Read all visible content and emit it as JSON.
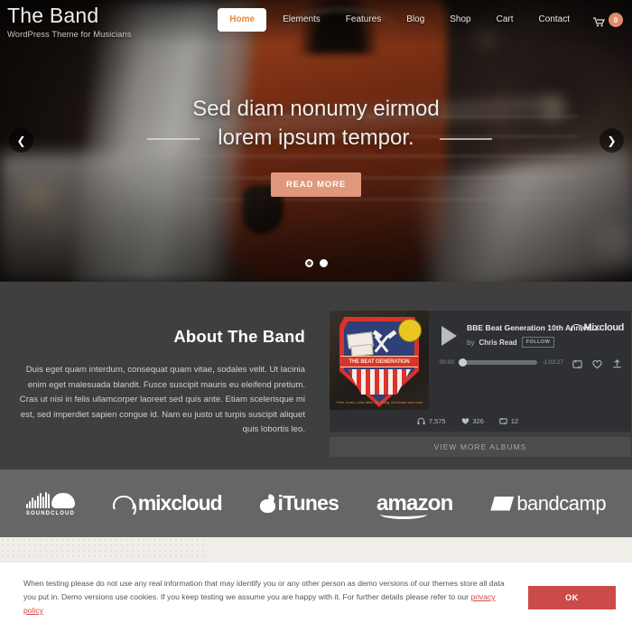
{
  "header": {
    "brand_title": "The Band",
    "brand_subtitle": "WordPress Theme for Musicians",
    "nav": [
      {
        "label": "Home",
        "active": true
      },
      {
        "label": "Elements",
        "active": false
      },
      {
        "label": "Features",
        "active": false
      },
      {
        "label": "Blog",
        "active": false
      },
      {
        "label": "Shop",
        "active": false
      },
      {
        "label": "Cart",
        "active": false
      },
      {
        "label": "Contact",
        "active": false
      }
    ],
    "cart_icon": "shopping-cart-icon",
    "cart_count": "0",
    "accent_color": "#e8883e",
    "badge_color": "#e08a6b"
  },
  "hero": {
    "title_line1": "Sed diam nonumy eirmod",
    "title_line2": "lorem ipsum tempor.",
    "button_label": "READ MORE",
    "button_color": "#e0977c",
    "prev_icon": "chevron-left-icon",
    "next_icon": "chevron-right-icon",
    "slide_count": 2,
    "active_slide": 2
  },
  "about": {
    "heading": "About The Band",
    "paragraph": "Duis eget quam interdum, consequat quam vitae, sodales velit. Ut lacinia enim eget malesuada blandit. Fusce suscipit mauris eu eleifend pretium. Cras ut nisi in felis ullamcorper laoreet sed quis ante. Etiam scelerisque mi est, sed imperdiet sapien congue id. Nam eu justo ut turpis suscipit aliquet quis lobortis leo.",
    "background_color": "#3f3f3f"
  },
  "player": {
    "cover_alt": "the-beat-generation-album-art",
    "cover_banner_text": "THE BEAT GENERATION",
    "cover_footer_text": "Pete Jones, Little Mike, Mr Thing, Mr Brown and more",
    "play_icon": "play-icon",
    "track_title": "BBE Beat Generation 10th Annive...",
    "by_prefix": "by",
    "artist": "Chris Read",
    "follow_label": "FOLLOW",
    "service": "Mixcloud",
    "service_icon": "mixcloud-cloud-icon",
    "time_elapsed": "00:00",
    "time_remaining": "-1:03:27",
    "repost_icon": "repost-icon",
    "heart_icon": "heart-icon",
    "share_icon": "share-upload-icon",
    "stats": [
      {
        "icon": "headphones-icon",
        "value": "7,575"
      },
      {
        "icon": "heart-filled-icon",
        "value": "326"
      },
      {
        "icon": "repost-icon",
        "value": "12"
      }
    ],
    "view_more_label": "VIEW MORE ALBUMS",
    "background_color": "#2e3034"
  },
  "logos": {
    "background_color": "#666666",
    "items": [
      {
        "name": "soundcloud-logo",
        "label": "SOUNDCLOUD"
      },
      {
        "name": "mixcloud-logo",
        "label": "mixcloud"
      },
      {
        "name": "itunes-logo",
        "label": "iTunes"
      },
      {
        "name": "amazon-logo",
        "label": "amazon"
      },
      {
        "name": "bandcamp-logo",
        "label": "bandcamp"
      }
    ]
  },
  "cookie": {
    "text": "When testing please do not use any real information that may identify you or any other person as demo versions of our themes store all data you put in. Demo versions use cookies. If you keep testing we assume you are happy with it. For further details please refer to our",
    "link_label": "privacy policy",
    "ok_label": "OK",
    "ok_color": "#cd4a4a",
    "link_color": "#cf4b4b"
  }
}
